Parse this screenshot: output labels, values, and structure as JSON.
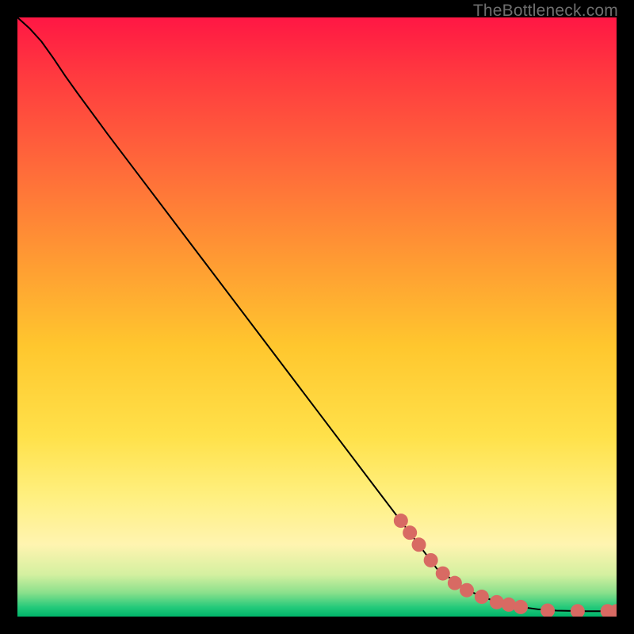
{
  "watermark": "TheBottleneck.com",
  "chart_data": {
    "type": "line",
    "title": "",
    "xlabel": "",
    "ylabel": "",
    "xlim": [
      0,
      100
    ],
    "ylim": [
      0,
      100
    ],
    "grid": false,
    "legend": false,
    "background_gradient": {
      "stops": [
        {
          "offset": 0.0,
          "color": "#ff1744"
        },
        {
          "offset": 0.1,
          "color": "#ff3b3f"
        },
        {
          "offset": 0.25,
          "color": "#ff6a3a"
        },
        {
          "offset": 0.4,
          "color": "#ff9933"
        },
        {
          "offset": 0.55,
          "color": "#ffc72e"
        },
        {
          "offset": 0.7,
          "color": "#ffe14a"
        },
        {
          "offset": 0.8,
          "color": "#fff080"
        },
        {
          "offset": 0.88,
          "color": "#fff4b0"
        },
        {
          "offset": 0.93,
          "color": "#d4f0a0"
        },
        {
          "offset": 0.96,
          "color": "#8be08c"
        },
        {
          "offset": 0.985,
          "color": "#22c97a"
        },
        {
          "offset": 1.0,
          "color": "#00b46a"
        }
      ]
    },
    "series": [
      {
        "name": "bottleneck-curve",
        "color": "#000000",
        "x": [
          0.0,
          2.0,
          4.0,
          6.0,
          8.0,
          10.0,
          15.0,
          20.0,
          30.0,
          40.0,
          50.0,
          60.0,
          66.0,
          70.0,
          75.0,
          80.0,
          84.0,
          87.0,
          90.0,
          92.5,
          95.0,
          98.0,
          100.0
        ],
        "values": [
          100.0,
          98.2,
          96.0,
          93.2,
          90.2,
          87.4,
          80.6,
          74.0,
          60.8,
          47.6,
          34.4,
          21.2,
          13.3,
          8.0,
          4.4,
          2.4,
          1.6,
          1.2,
          1.0,
          0.95,
          0.9,
          0.9,
          0.9
        ]
      }
    ],
    "markers": {
      "name": "highlighted-range",
      "color": "#d86a63",
      "radius_px": 9,
      "points": [
        {
          "x": 64.0,
          "y": 16.0
        },
        {
          "x": 65.5,
          "y": 14.0
        },
        {
          "x": 67.0,
          "y": 12.0
        },
        {
          "x": 69.0,
          "y": 9.4
        },
        {
          "x": 71.0,
          "y": 7.2
        },
        {
          "x": 73.0,
          "y": 5.6
        },
        {
          "x": 75.0,
          "y": 4.4
        },
        {
          "x": 77.5,
          "y": 3.3
        },
        {
          "x": 80.0,
          "y": 2.4
        },
        {
          "x": 82.0,
          "y": 2.0
        },
        {
          "x": 84.0,
          "y": 1.6
        },
        {
          "x": 88.5,
          "y": 1.0
        },
        {
          "x": 93.5,
          "y": 0.9
        },
        {
          "x": 98.5,
          "y": 0.9
        },
        {
          "x": 100.0,
          "y": 0.9
        }
      ]
    }
  }
}
